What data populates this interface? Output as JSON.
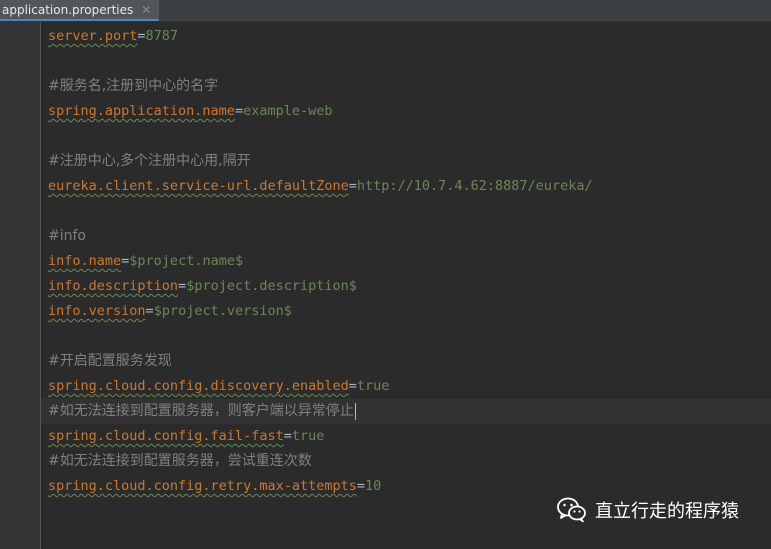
{
  "tab": {
    "title": "application.properties",
    "close_glyph": "✕"
  },
  "lines": [
    {
      "type": "prop",
      "key": "server.port",
      "eq": "=",
      "value": "8787"
    },
    {
      "type": "blank"
    },
    {
      "type": "comment",
      "text": "#服务名,注册到中心的名字"
    },
    {
      "type": "prop",
      "key": "spring.application.name",
      "eq": "=",
      "value": "example-web"
    },
    {
      "type": "blank"
    },
    {
      "type": "comment",
      "text": "#注册中心,多个注册中心用,隔开"
    },
    {
      "type": "prop",
      "key": "eureka.client.service-url.defaultZone",
      "eq": "=",
      "value": "http://10.7.4.62:8887/eureka/"
    },
    {
      "type": "blank"
    },
    {
      "type": "comment",
      "text": "#info"
    },
    {
      "type": "prop",
      "key": "info.name",
      "eq": "=",
      "value": "$project.name$"
    },
    {
      "type": "prop",
      "key": "info.description",
      "eq": "=",
      "value": "$project.description$"
    },
    {
      "type": "prop",
      "key": "info.version",
      "eq": "=",
      "value": "$project.version$"
    },
    {
      "type": "blank"
    },
    {
      "type": "comment",
      "text": "#开启配置服务发现"
    },
    {
      "type": "prop",
      "key": "spring.cloud.config.discovery.enabled",
      "eq": "=",
      "value": "true"
    },
    {
      "type": "comment",
      "text": "#如无法连接到配置服务器，则客户端以异常停止",
      "current": true
    },
    {
      "type": "prop",
      "key": "spring.cloud.config.fail-fast",
      "eq": "=",
      "value": "true"
    },
    {
      "type": "comment",
      "text": "#如无法连接到配置服务器，尝试重连次数"
    },
    {
      "type": "prop",
      "key": "spring.cloud.config.retry.max-attempts",
      "eq": "=",
      "value": "10"
    }
  ],
  "watermark": {
    "icon": "wechat-icon",
    "text": "直立行走的程序猿"
  },
  "colors": {
    "background": "#2b2b2b",
    "key": "#cc7832",
    "value": "#6a8759",
    "comment": "#808080"
  }
}
